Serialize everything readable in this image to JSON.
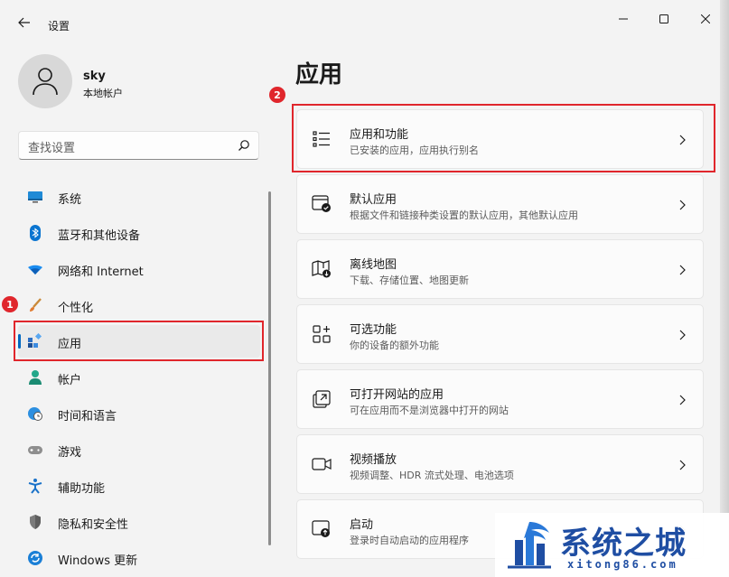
{
  "window": {
    "title": "设置",
    "controls": {
      "minimize": "minimize-icon",
      "maximize": "maximize-icon",
      "close": "close-icon"
    }
  },
  "profile": {
    "name": "sky",
    "account_type": "本地帐户"
  },
  "search": {
    "placeholder": "查找设置"
  },
  "sidebar": {
    "items": [
      {
        "label": "系统",
        "icon": "monitor-icon"
      },
      {
        "label": "蓝牙和其他设备",
        "icon": "bluetooth-icon"
      },
      {
        "label": "网络和 Internet",
        "icon": "wifi-icon"
      },
      {
        "label": "个性化",
        "icon": "brush-icon"
      },
      {
        "label": "应用",
        "icon": "apps-icon",
        "selected": true
      },
      {
        "label": "帐户",
        "icon": "person-icon"
      },
      {
        "label": "时间和语言",
        "icon": "globe-clock-icon"
      },
      {
        "label": "游戏",
        "icon": "gamepad-icon"
      },
      {
        "label": "辅助功能",
        "icon": "accessibility-icon"
      },
      {
        "label": "隐私和安全性",
        "icon": "shield-icon"
      },
      {
        "label": "Windows 更新",
        "icon": "update-icon"
      }
    ]
  },
  "annotations": {
    "badge1": "1",
    "badge2": "2",
    "highlight_color": "#e0262c"
  },
  "main": {
    "heading": "应用",
    "cards": [
      {
        "title": "应用和功能",
        "desc": "已安装的应用，应用执行别名",
        "icon": "list-icon"
      },
      {
        "title": "默认应用",
        "desc": "根据文件和链接种类设置的默认应用，其他默认应用",
        "icon": "default-app-icon"
      },
      {
        "title": "离线地图",
        "desc": "下载、存储位置、地图更新",
        "icon": "map-download-icon"
      },
      {
        "title": "可选功能",
        "desc": "你的设备的额外功能",
        "icon": "add-grid-icon"
      },
      {
        "title": "可打开网站的应用",
        "desc": "可在应用而不是浏览器中打开的网站",
        "icon": "open-external-icon"
      },
      {
        "title": "视频播放",
        "desc": "视频调整、HDR 流式处理、电池选项",
        "icon": "video-icon"
      },
      {
        "title": "启动",
        "desc": "登录时自动启动的应用程序",
        "icon": "startup-icon"
      }
    ]
  },
  "watermark": {
    "text": "系统之城",
    "sub": "xitong86.com"
  },
  "colors": {
    "accent": "#0067c0",
    "background": "#f3f3f3",
    "card": "#fbfbfb"
  }
}
